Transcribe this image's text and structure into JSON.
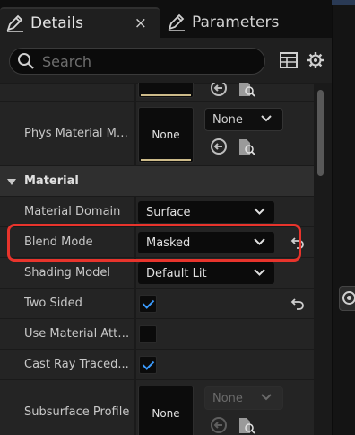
{
  "tabs": {
    "details_label": "Details",
    "close_glyph": "×",
    "parameters_label": "Parameters"
  },
  "search": {
    "placeholder": "Search",
    "value": ""
  },
  "toolbar": {
    "table_icon": "table-view-icon",
    "settings_icon": "gear-icon"
  },
  "properties": {
    "phys_material": {
      "label": "Phys Material Ma...",
      "thumb_text": "None",
      "dropdown_value": "None"
    },
    "category": {
      "label": "Material"
    },
    "material_domain": {
      "label": "Material Domain",
      "value": "Surface"
    },
    "blend_mode": {
      "label": "Blend Mode",
      "value": "Masked"
    },
    "shading_model": {
      "label": "Shading Model",
      "value": "Default Lit"
    },
    "two_sided": {
      "label": "Two Sided",
      "checked": true
    },
    "use_material_attributes": {
      "label": "Use Material Attri...",
      "checked": false
    },
    "cast_ray_traced_shadows": {
      "label": "Cast Ray Traced...",
      "checked": true
    },
    "subsurface_profile": {
      "label": "Subsurface Profile",
      "thumb_text": "None",
      "dropdown_value": "None"
    }
  },
  "colors": {
    "highlight": "#e8342c",
    "checkbox_check": "#3b9cff",
    "thumb_underline": "#cdbb8a"
  }
}
